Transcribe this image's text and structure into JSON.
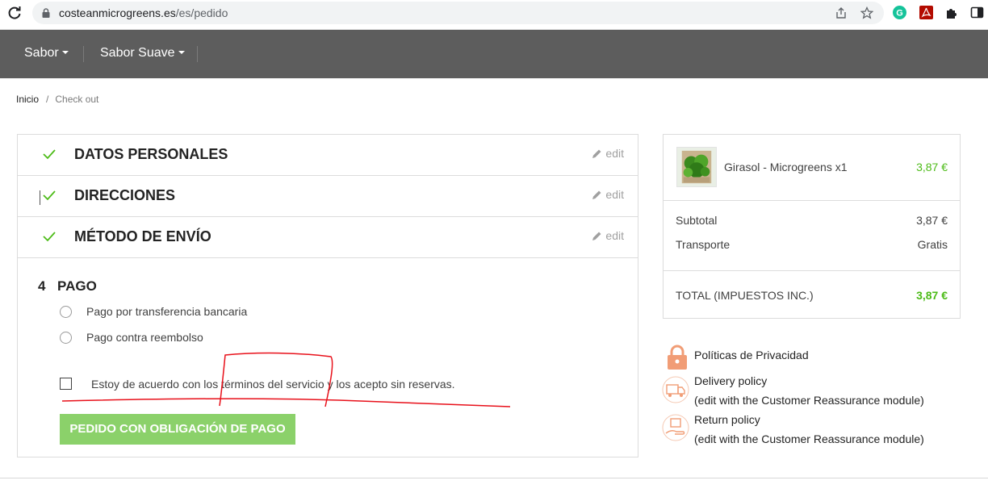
{
  "browser": {
    "url_host": "costeanmicrogreens.es",
    "url_path": "/es/pedido"
  },
  "nav": {
    "items": [
      {
        "label": "Sabor"
      },
      {
        "label": "Sabor Suave"
      }
    ]
  },
  "breadcrumb": {
    "home": "Inicio",
    "separator": "/",
    "current": "Check out"
  },
  "checkout": {
    "steps": [
      {
        "title": "DATOS PERSONALES",
        "edit": "edit"
      },
      {
        "title": "DIRECCIONES",
        "edit": "edit"
      },
      {
        "title": "MÉTODO DE ENVÍO",
        "edit": "edit"
      }
    ],
    "payment": {
      "number": "4",
      "title": "PAGO",
      "options": [
        {
          "label": "Pago por transferencia bancaria"
        },
        {
          "label": "Pago contra reembolso"
        }
      ],
      "terms": "Estoy de acuerdo con los términos del servicio y los acepto sin reservas.",
      "order_button": "PEDIDO CON OBLIGACIÓN DE PAGO"
    }
  },
  "cart": {
    "product_name": "Girasol - Microgreens x1",
    "product_price": "3,87 €",
    "subtotal_label": "Subtotal",
    "subtotal_value": "3,87 €",
    "shipping_label": "Transporte",
    "shipping_value": "Gratis",
    "total_label": "TOTAL (IMPUESTOS INC.)",
    "total_value": "3,87 €"
  },
  "reassurance": {
    "privacy": "Políticas de Privacidad",
    "delivery_title": "Delivery policy",
    "delivery_sub": "(edit with the Customer Reassurance module)",
    "return_title": "Return policy",
    "return_sub": "(edit with the Customer Reassurance module)"
  },
  "colors": {
    "accent_green": "#4cbb17",
    "button_green": "#8bd16a",
    "nav_bg": "#5d5d5d",
    "annotation_red": "#e8101a"
  }
}
